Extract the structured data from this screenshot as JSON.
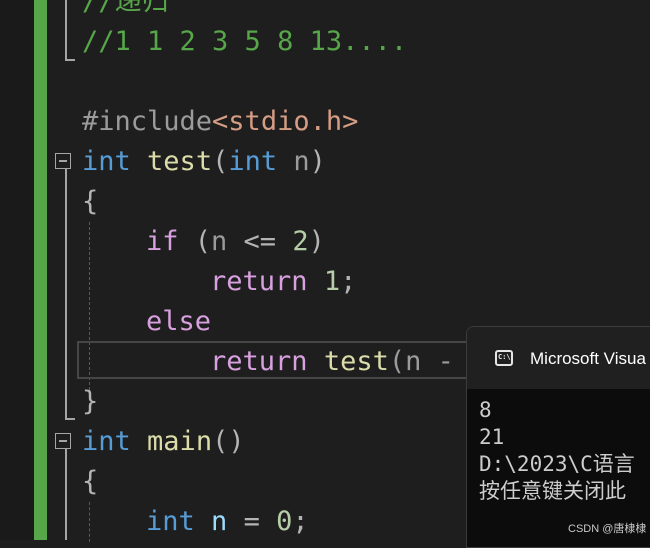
{
  "editor": {
    "lines": {
      "comment_recursion": "//递归",
      "comment_sequence": "//1 1 2 3 5 8 13....",
      "include_directive": "#include",
      "include_header": "<stdio.h>",
      "test_kw_int": "int",
      "test_name": "test",
      "test_paren_open": "(",
      "test_param_kw": "int",
      "test_param": " n",
      "test_paren_close": ")",
      "brace_open_1": "{",
      "if_kw": "if",
      "if_cond_open": " (",
      "if_n": "n",
      "if_op": " <= ",
      "if_num": "2",
      "if_close": ")",
      "return1_kw": "return",
      "return1_num": "1",
      "return1_semi": ";",
      "else_kw": "else",
      "return2_kw": "return",
      "return2_fn": "test",
      "return2_rest": "(n -",
      "brace_close_1": "}",
      "main_kw_int": "int",
      "main_name": "main",
      "main_parens": "()",
      "brace_open_2": "{",
      "decl_kw": "int",
      "decl_var": "n",
      "decl_op": " = ",
      "decl_num": "0",
      "decl_semi": ";"
    }
  },
  "console": {
    "title": "Microsoft Visua",
    "icon": "console-app-icon",
    "icon_text": "C:\\",
    "output": [
      "8",
      "21",
      "D:\\2023\\C语言",
      "按任意键关闭此"
    ]
  },
  "watermark": "CSDN @唐棣棣",
  "colors": {
    "background": "#1e1e1e",
    "change_bar": "#57a64a",
    "keyword": "#569cd6",
    "control_keyword": "#d8a0df",
    "function": "#dcdcaa",
    "number": "#b5cea8",
    "comment": "#57a64a",
    "string": "#d69d85"
  }
}
